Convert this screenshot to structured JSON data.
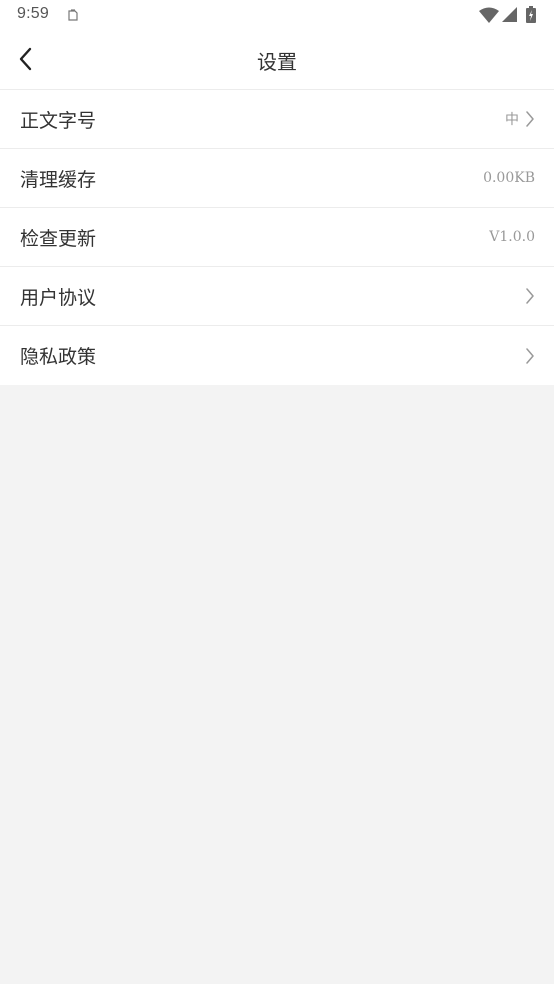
{
  "status_bar": {
    "time": "9:59",
    "notification_icon": "clipboard-icon",
    "wifi_icon": "wifi-icon",
    "signal_icon": "signal-icon",
    "battery_icon": "battery-icon"
  },
  "nav": {
    "back_icon": "chevron-left-icon",
    "title": "设置"
  },
  "settings": {
    "items": [
      {
        "label": "正文字号",
        "value": "中",
        "chevron": true
      },
      {
        "label": "清理缓存",
        "value": "0.00KB",
        "chevron": false
      },
      {
        "label": "检查更新",
        "value": "V1.0.0",
        "chevron": false
      },
      {
        "label": "用户协议",
        "value": "",
        "chevron": true
      },
      {
        "label": "隐私政策",
        "value": "",
        "chevron": true
      }
    ]
  },
  "colors": {
    "background": "#f3f3f3",
    "surface": "#ffffff",
    "text_primary": "#333333",
    "text_secondary": "#999999",
    "divider": "#ececec"
  }
}
